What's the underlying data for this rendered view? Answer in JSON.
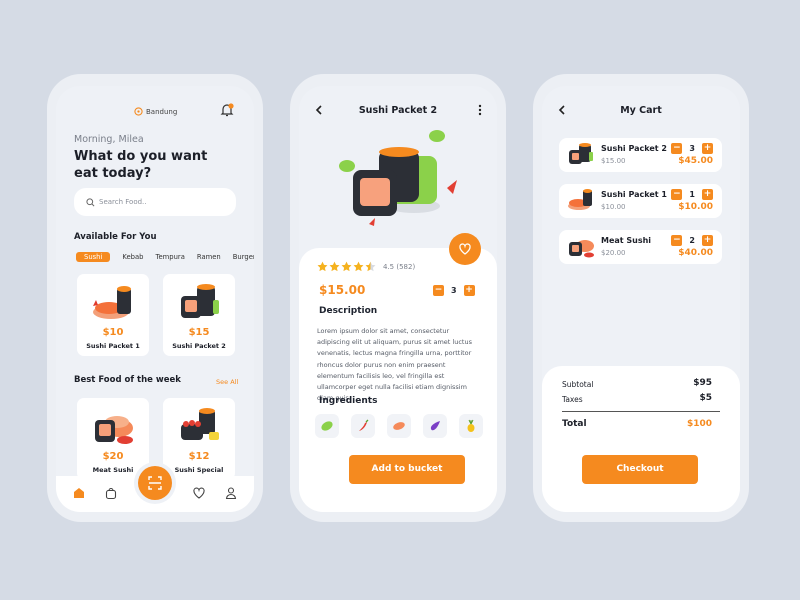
{
  "home": {
    "location": "Bandung",
    "greeting": "Morning, Milea",
    "headline": "What do you want eat today?",
    "search_placeholder": "Search Food..",
    "available_title": "Available For You",
    "tabs": [
      "Sushi",
      "Kebab",
      "Tempura",
      "Ramen",
      "Burger"
    ],
    "available": [
      {
        "price": "$10",
        "name": "Sushi Packet 1"
      },
      {
        "price": "$15",
        "name": "Sushi Packet 2"
      }
    ],
    "best_title": "Best Food of the week",
    "see_all": "See All",
    "best": [
      {
        "price": "$20",
        "name": "Meat Sushi"
      },
      {
        "price": "$12",
        "name": "Sushi Special"
      }
    ]
  },
  "detail": {
    "title": "Sushi Packet 2",
    "rating": "4.5 (582)",
    "rating_value": 4.5,
    "price": "$15.00",
    "quantity": "3",
    "minus": "−",
    "plus": "+",
    "description_title": "Description",
    "description": "Lorem ipsum dolor sit amet, consectetur adipiscing elit ut aliquam, purus sit amet luctus venenatis, lectus magna fringilla urna, porttitor rhoncus dolor purus non enim praesent elementum facilisis leo, vel fringilla est ullamcorper eget nulla facilisi etiam dignissim diam quis",
    "ingredients_title": "Ingredients",
    "ingredients_icons": [
      "leaf-icon",
      "chili-icon",
      "salmon-icon",
      "eggplant-icon",
      "pineapple-icon"
    ],
    "add_button": "Add to bucket"
  },
  "cart": {
    "title": "My Cart",
    "items": [
      {
        "name": "Sushi Packet 2",
        "unit_price": "$15.00",
        "qty": "3",
        "total": "$45.00"
      },
      {
        "name": "Sushi Packet 1",
        "unit_price": "$10.00",
        "qty": "1",
        "total": "$10.00"
      },
      {
        "name": "Meat Sushi",
        "unit_price": "$20.00",
        "qty": "2",
        "total": "$40.00"
      }
    ],
    "subtotal_label": "Subtotal",
    "subtotal": "$95",
    "taxes_label": "Taxes",
    "taxes": "$5",
    "total_label": "Total",
    "total": "$100",
    "checkout": "Checkout"
  },
  "colors": {
    "accent": "#f58a1f",
    "background": "#d5dbe5",
    "screen": "#eef1f6"
  }
}
